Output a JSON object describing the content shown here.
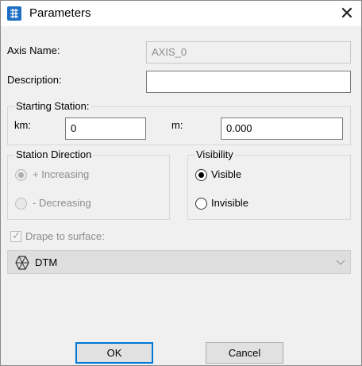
{
  "window": {
    "title": "Parameters"
  },
  "axis_name": {
    "label": "Axis Name:",
    "value": "AXIS_0"
  },
  "description": {
    "label": "Description:",
    "value": ""
  },
  "starting_station": {
    "legend": "Starting Station:",
    "km_label": "km:",
    "km_value": "0",
    "m_label": "m:",
    "m_value": "0.000"
  },
  "station_direction": {
    "legend": "Station Direction",
    "options": [
      {
        "label": "+ Increasing",
        "checked": true,
        "enabled": false
      },
      {
        "label": "- Decreasing",
        "checked": false,
        "enabled": false
      }
    ]
  },
  "visibility": {
    "legend": "Visibility",
    "options": [
      {
        "label": "Visible",
        "checked": true
      },
      {
        "label": "Invisible",
        "checked": false
      }
    ]
  },
  "drape": {
    "label": "Drape to surface:",
    "checked": true,
    "enabled": false
  },
  "surface_select": {
    "value": "DTM",
    "icon": "surface-mesh-icon"
  },
  "buttons": {
    "ok": "OK",
    "cancel": "Cancel"
  }
}
